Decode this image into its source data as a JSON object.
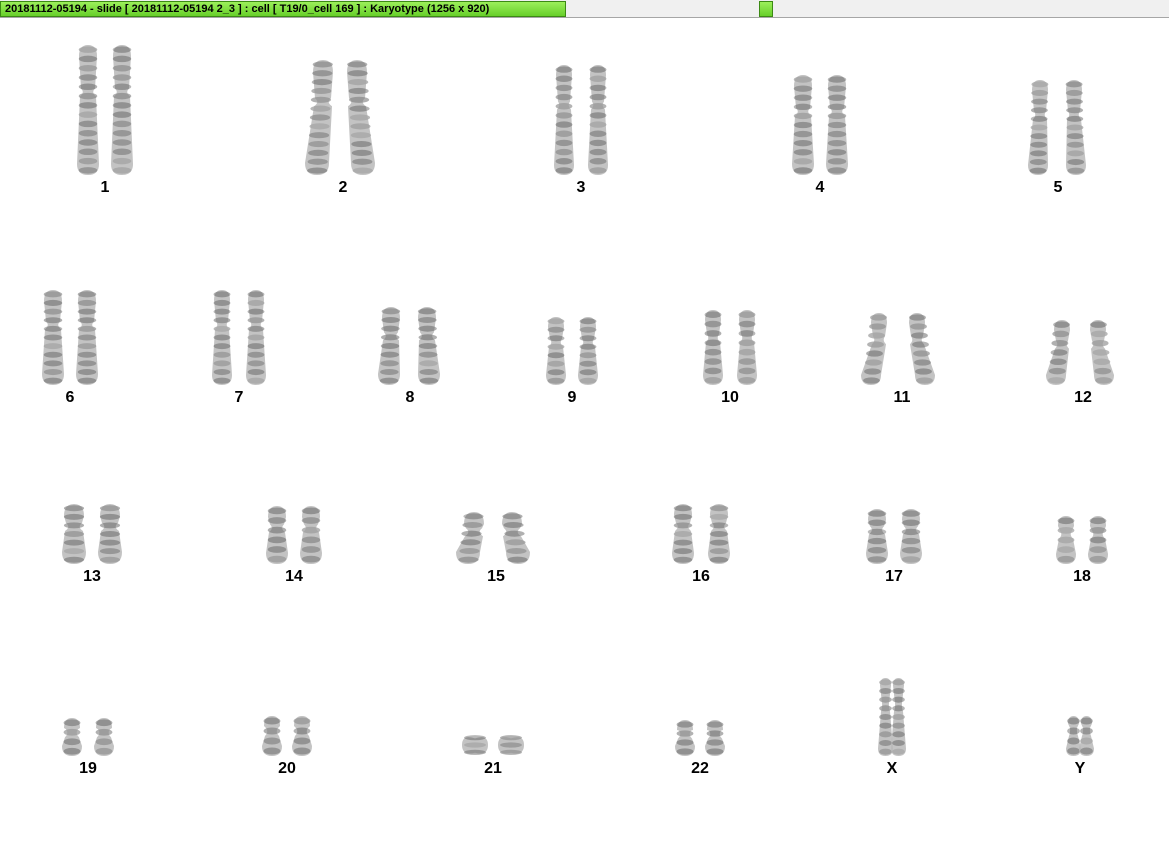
{
  "window": {
    "title": "20181112-05194 - slide [ 20181112-05194 2_3 ] : cell [ T19/0_cell 169 ] : Karyotype  (1256 x 920)"
  },
  "karyotype": {
    "chromosomes": [
      {
        "label": "1"
      },
      {
        "label": "2"
      },
      {
        "label": "3"
      },
      {
        "label": "4"
      },
      {
        "label": "5"
      },
      {
        "label": "6"
      },
      {
        "label": "7"
      },
      {
        "label": "8"
      },
      {
        "label": "9"
      },
      {
        "label": "10"
      },
      {
        "label": "11"
      },
      {
        "label": "12"
      },
      {
        "label": "13"
      },
      {
        "label": "14"
      },
      {
        "label": "15"
      },
      {
        "label": "16"
      },
      {
        "label": "17"
      },
      {
        "label": "18"
      },
      {
        "label": "19"
      },
      {
        "label": "20"
      },
      {
        "label": "21"
      },
      {
        "label": "22"
      },
      {
        "label": "X"
      },
      {
        "label": "Y"
      }
    ]
  }
}
